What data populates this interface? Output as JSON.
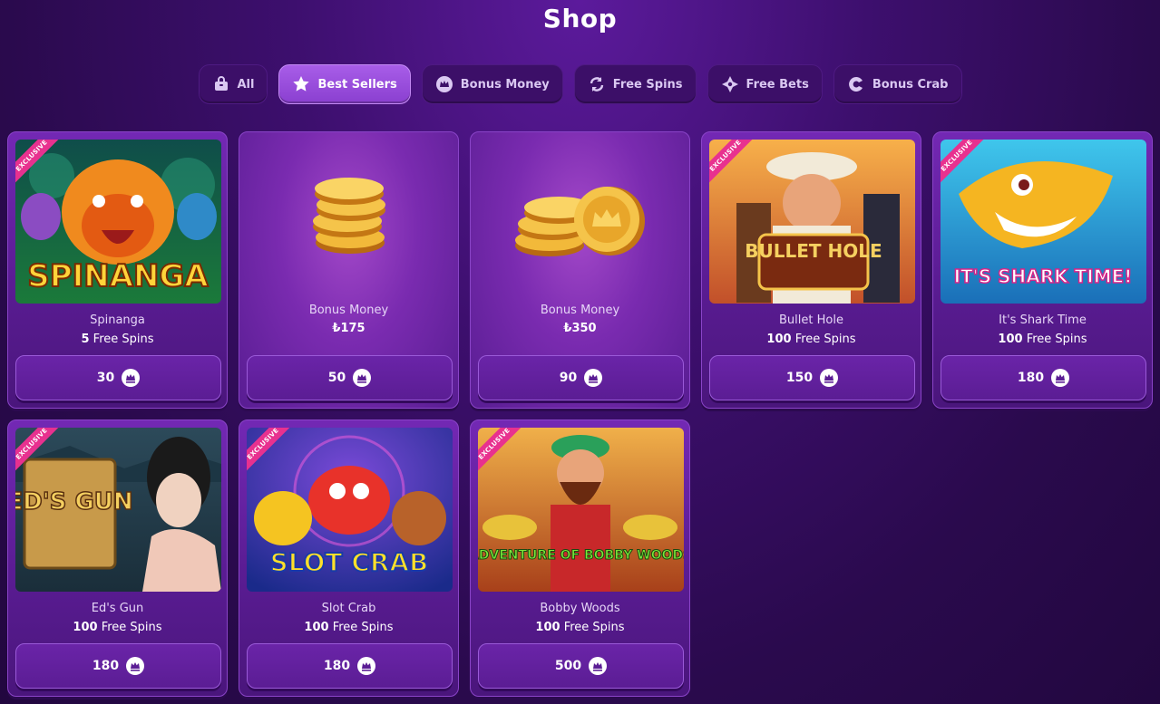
{
  "page": {
    "title": "Shop"
  },
  "tabs": [
    {
      "label": "All",
      "icon": "bag-icon",
      "active": false
    },
    {
      "label": "Best Sellers",
      "icon": "star-icon",
      "active": true
    },
    {
      "label": "Bonus Money",
      "icon": "crown-coin-icon",
      "active": false
    },
    {
      "label": "Free Spins",
      "icon": "refresh-icon",
      "active": false
    },
    {
      "label": "Free Bets",
      "icon": "sparkle-icon",
      "active": false
    },
    {
      "label": "Bonus Crab",
      "icon": "crab-claw-icon",
      "active": false
    }
  ],
  "ribbon_text": "EXCLUSIVE",
  "currency_symbol": "₺",
  "products": [
    {
      "name": "Spinanga",
      "amount": "5",
      "unit": "Free Spins",
      "price": "30",
      "exclusive": true,
      "kind": "game",
      "art_text": "SPINANGA"
    },
    {
      "name": "Bonus Money",
      "amount": "₺175",
      "unit": "",
      "price": "50",
      "exclusive": false,
      "kind": "coins-small"
    },
    {
      "name": "Bonus Money",
      "amount": "₺350",
      "unit": "",
      "price": "90",
      "exclusive": false,
      "kind": "coins-large"
    },
    {
      "name": "Bullet Hole",
      "amount": "100",
      "unit": "Free Spins",
      "price": "150",
      "exclusive": true,
      "kind": "game",
      "art_text": "BULLET HOLE"
    },
    {
      "name": "It's Shark Time",
      "amount": "100",
      "unit": "Free Spins",
      "price": "180",
      "exclusive": true,
      "kind": "game",
      "art_text": "IT'S SHARK TIME!"
    },
    {
      "name": "Ed's Gun",
      "amount": "100",
      "unit": "Free Spins",
      "price": "180",
      "exclusive": true,
      "kind": "game",
      "art_text": "ED'S GUN"
    },
    {
      "name": "Slot Crab",
      "amount": "100",
      "unit": "Free Spins",
      "price": "180",
      "exclusive": true,
      "kind": "game",
      "art_text": "SLOT CRAB"
    },
    {
      "name": "Bobby Woods",
      "amount": "100",
      "unit": "Free Spins",
      "price": "500",
      "exclusive": true,
      "kind": "game",
      "art_text": "ADVENTURE OF BOBBY WOODS"
    }
  ],
  "colors": {
    "accent": "#a85de8",
    "ribbon": "#e8318f",
    "card": "#6424a4"
  }
}
